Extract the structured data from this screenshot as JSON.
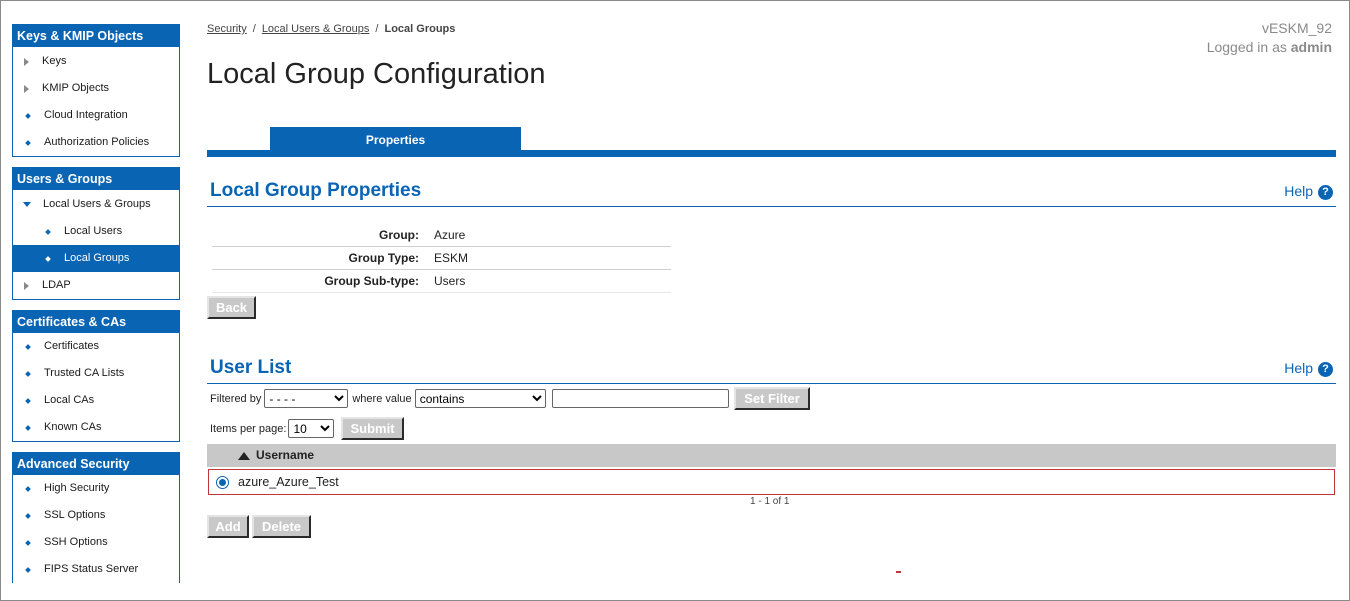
{
  "sidebar": {
    "sections": [
      {
        "title": "Keys & KMIP Objects",
        "items": [
          {
            "label": "Keys",
            "icon": "triangle-right-icon"
          },
          {
            "label": "KMIP Objects",
            "icon": "triangle-right-icon"
          },
          {
            "label": "Cloud Integration",
            "icon": "bullet-icon"
          },
          {
            "label": "Authorization Policies",
            "icon": "bullet-icon"
          }
        ]
      },
      {
        "title": "Users & Groups",
        "items": [
          {
            "label": "Local Users & Groups",
            "icon": "triangle-down-icon"
          },
          {
            "label": "Local Users",
            "icon": "bullet-icon"
          },
          {
            "label": "Local Groups",
            "icon": "bullet-icon"
          },
          {
            "label": "LDAP",
            "icon": "triangle-right-icon"
          }
        ]
      },
      {
        "title": "Certificates & CAs",
        "items": [
          {
            "label": "Certificates",
            "icon": "bullet-icon"
          },
          {
            "label": "Trusted CA Lists",
            "icon": "bullet-icon"
          },
          {
            "label": "Local CAs",
            "icon": "bullet-icon"
          },
          {
            "label": "Known CAs",
            "icon": "bullet-icon"
          }
        ]
      },
      {
        "title": "Advanced Security",
        "items": [
          {
            "label": "High Security",
            "icon": "bullet-icon"
          },
          {
            "label": "SSL Options",
            "icon": "bullet-icon"
          },
          {
            "label": "SSH Options",
            "icon": "bullet-icon"
          },
          {
            "label": "FIPS Status Server",
            "icon": "bullet-icon"
          }
        ]
      }
    ],
    "active_item": "Local Groups"
  },
  "breadcrumb": {
    "items": [
      "Security",
      "Local Users & Groups"
    ],
    "current": "Local Groups",
    "separator": "/"
  },
  "header": {
    "host": "vESKM_92",
    "logged_in_prefix": "Logged in as ",
    "user": "admin",
    "page_title": "Local Group Configuration"
  },
  "tabs": [
    {
      "label": "Properties",
      "active": true
    }
  ],
  "properties": {
    "title": "Local Group Properties",
    "help_label": "Help",
    "rows": [
      {
        "label": "Group:",
        "value": "Azure"
      },
      {
        "label": "Group Type:",
        "value": "ESKM"
      },
      {
        "label": "Group Sub-type:",
        "value": "Users"
      }
    ],
    "back_label": "Back"
  },
  "user_list": {
    "title": "User List",
    "help_label": "Help",
    "filter": {
      "filtered_by_label": "Filtered by",
      "filtered_by_value": "- - - -",
      "where_value_label": "where value",
      "condition_value": "contains",
      "text_value": "",
      "set_filter_label": "Set Filter"
    },
    "items_per_page_label": "Items per page:",
    "items_per_page_value": "10",
    "submit_label": "Submit",
    "column_header": "Username",
    "rows": [
      {
        "username": "azure_Azure_Test",
        "selected": true
      }
    ],
    "pager_text": "1 - 1 of 1",
    "add_label": "Add",
    "delete_label": "Delete"
  },
  "colors": {
    "accent": "#0a64b4",
    "button_gray": "#c8c8c8",
    "selection_border": "#c0373b"
  }
}
